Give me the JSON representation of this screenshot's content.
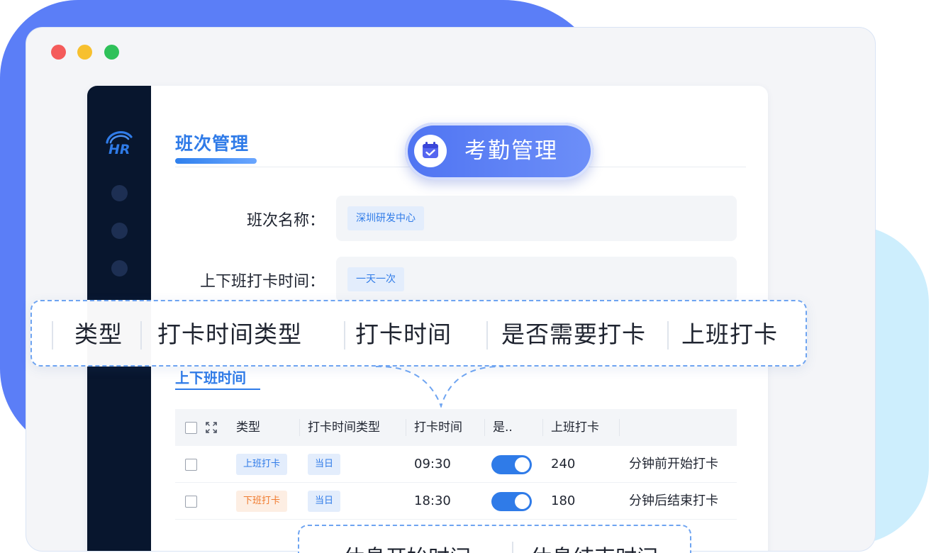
{
  "badge": {
    "label": "考勤管理",
    "icon": "calendar-check-icon",
    "color": "#5b7ef7"
  },
  "sidebar": {
    "logo_text": "HR"
  },
  "tab": {
    "label": "班次管理"
  },
  "form": {
    "shift_name_label": "班次名称：",
    "shift_name_value": "深圳研发中心",
    "clock_time_label": "上下班打卡时间：",
    "clock_time_value": "一天一次"
  },
  "callout": {
    "columns": [
      "类型",
      "打卡时间类型",
      "打卡时间",
      "是否需要打卡",
      "上班打卡"
    ]
  },
  "section": {
    "title": "上下班时间"
  },
  "table": {
    "headers": [
      "类型",
      "打卡时间类型",
      "打卡时间",
      "是..",
      "上班打卡"
    ],
    "rows": [
      {
        "type": "上班打卡",
        "time_type": "当日",
        "time": "09:30",
        "required": true,
        "minutes": "240",
        "note": "分钟前开始打卡"
      },
      {
        "type": "下班打卡",
        "time_type": "当日",
        "time": "18:30",
        "required": true,
        "minutes": "180",
        "note": "分钟后结束打卡"
      }
    ]
  },
  "bottom_callout": {
    "columns": [
      "休息开始时间",
      "休息结束时间"
    ]
  },
  "colors": {
    "accent": "#2f7be8",
    "sidebar": "#08162e",
    "orange": "#f07b2e"
  }
}
